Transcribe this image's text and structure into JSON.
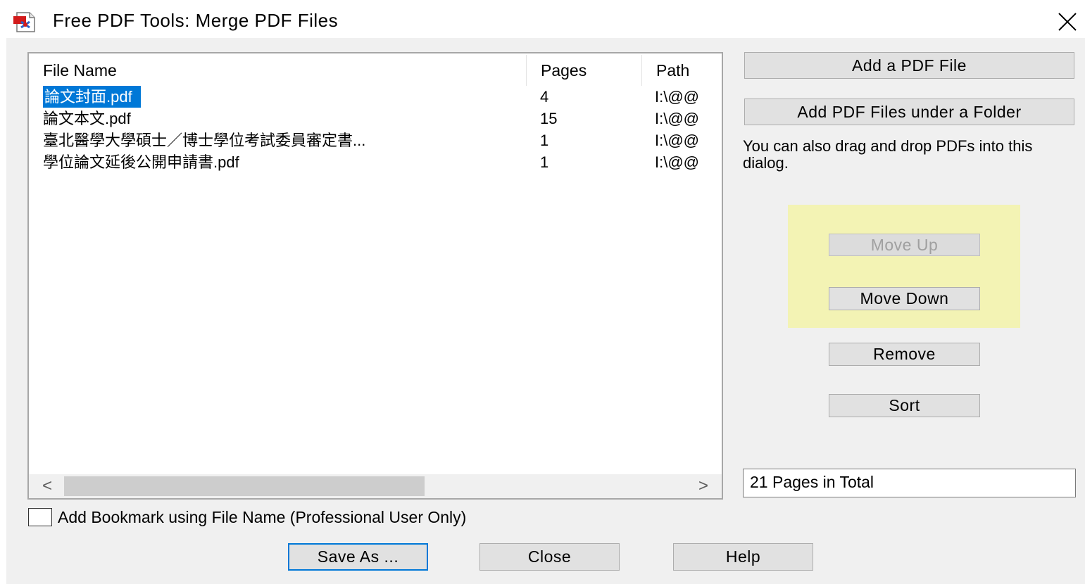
{
  "window": {
    "title": "Free PDF Tools: Merge PDF Files"
  },
  "file_list": {
    "columns": {
      "name": "File Name",
      "pages": "Pages",
      "path": "Path"
    },
    "rows": [
      {
        "name": "論文封面.pdf",
        "pages": "4",
        "path": "I:\\@@",
        "selected": true
      },
      {
        "name": "論文本文.pdf",
        "pages": "15",
        "path": "I:\\@@",
        "selected": false
      },
      {
        "name": "臺北醫學大學碩士／博士學位考試委員審定書...",
        "pages": "1",
        "path": "I:\\@@",
        "selected": false
      },
      {
        "name": "學位論文延後公開申請書.pdf",
        "pages": "1",
        "path": "I:\\@@",
        "selected": false
      }
    ]
  },
  "actions": {
    "add_file": "Add a PDF File",
    "add_folder": "Add PDF Files under a Folder",
    "hint": "You can also drag and drop PDFs into this dialog.",
    "move_up": "Move Up",
    "move_down": "Move Down",
    "remove": "Remove",
    "sort": "Sort"
  },
  "total": "21 Pages in Total",
  "bookmark_option": {
    "label": "Add Bookmark using File Name (Professional User Only)",
    "checked": false
  },
  "footer": {
    "save_as": "Save As ...",
    "close": "Close",
    "help": "Help"
  },
  "colors": {
    "selection": "#0078d7",
    "highlight": "#f3f3b4",
    "dialog_bg": "#f0f0f0"
  }
}
